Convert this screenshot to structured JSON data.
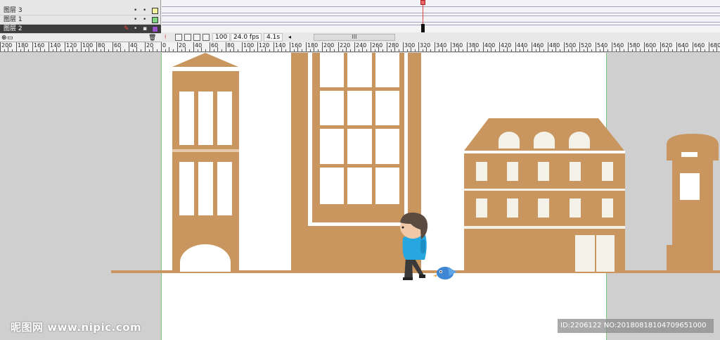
{
  "layers": [
    {
      "name": "图层 3",
      "color": "#f4f4a0",
      "selected": false
    },
    {
      "name": "图层 1",
      "color": "#7ed37e",
      "selected": false
    },
    {
      "name": "图层 2",
      "color": "#9a52c8",
      "selected": true
    }
  ],
  "status": {
    "current_frame": "100",
    "fps": "24.0 fps",
    "elapsed": "4.1s",
    "scroll_glyph": "III"
  },
  "ruler": {
    "labels": [
      "200",
      "180",
      "160",
      "140",
      "120",
      "100",
      "80",
      "60",
      "40",
      "20",
      "0",
      "20",
      "40",
      "60",
      "80",
      "100",
      "120",
      "140",
      "160",
      "180",
      "200",
      "220",
      "240",
      "260",
      "280",
      "300",
      "320",
      "340",
      "360",
      "380",
      "400",
      "420",
      "440",
      "460",
      "480",
      "500",
      "520",
      "540",
      "560",
      "580",
      "600",
      "620",
      "640",
      "660",
      "680"
    ]
  },
  "scene": {
    "building_color": "#c9965f",
    "window_color": "#ffffff",
    "cream_window_color": "#f4f1e9",
    "character_shirt": "#27a7e0",
    "character_hair": "#5a4a40",
    "bird_color": "#3f86d4"
  },
  "watermark": {
    "left": "昵图网 www.nipic.com",
    "right": "ID:2206122 NO:20180818104709651000"
  }
}
